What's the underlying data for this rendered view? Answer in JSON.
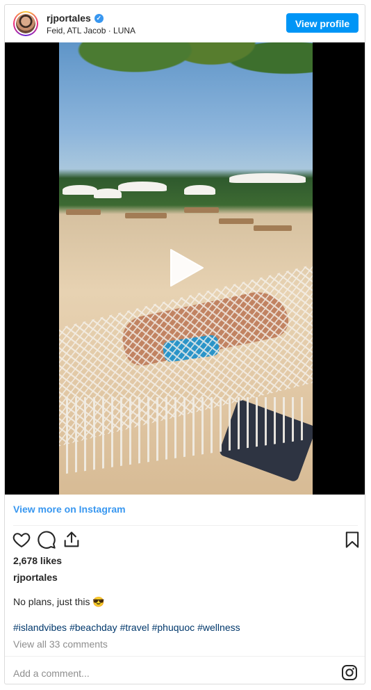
{
  "header": {
    "username": "rjportales",
    "verified_mark": "✓",
    "subtitle": "Feid, ATL Jacob · LUNA",
    "view_profile_label": "View profile"
  },
  "media": {
    "play_icon": "play-icon",
    "description_icon": "hammock-beach-photo"
  },
  "links": {
    "view_more": "View more on Instagram"
  },
  "actions": {
    "like_icon": "heart-icon",
    "comment_icon": "comment-icon",
    "share_icon": "share-icon",
    "save_icon": "bookmark-icon"
  },
  "post": {
    "likes": "2,678 likes",
    "owner": "rjportales",
    "caption": "No plans, just this 😎",
    "hashtags": [
      "#islandvibes",
      "#beachday",
      "#travel",
      "#phuquoc",
      "#wellness"
    ],
    "view_comments": "View all 33 comments"
  },
  "comment": {
    "placeholder": "Add a comment..."
  },
  "colors": {
    "accent": "#0095f6",
    "link": "#3897f0",
    "hashtag": "#00376b",
    "muted": "#8e8e8e"
  }
}
